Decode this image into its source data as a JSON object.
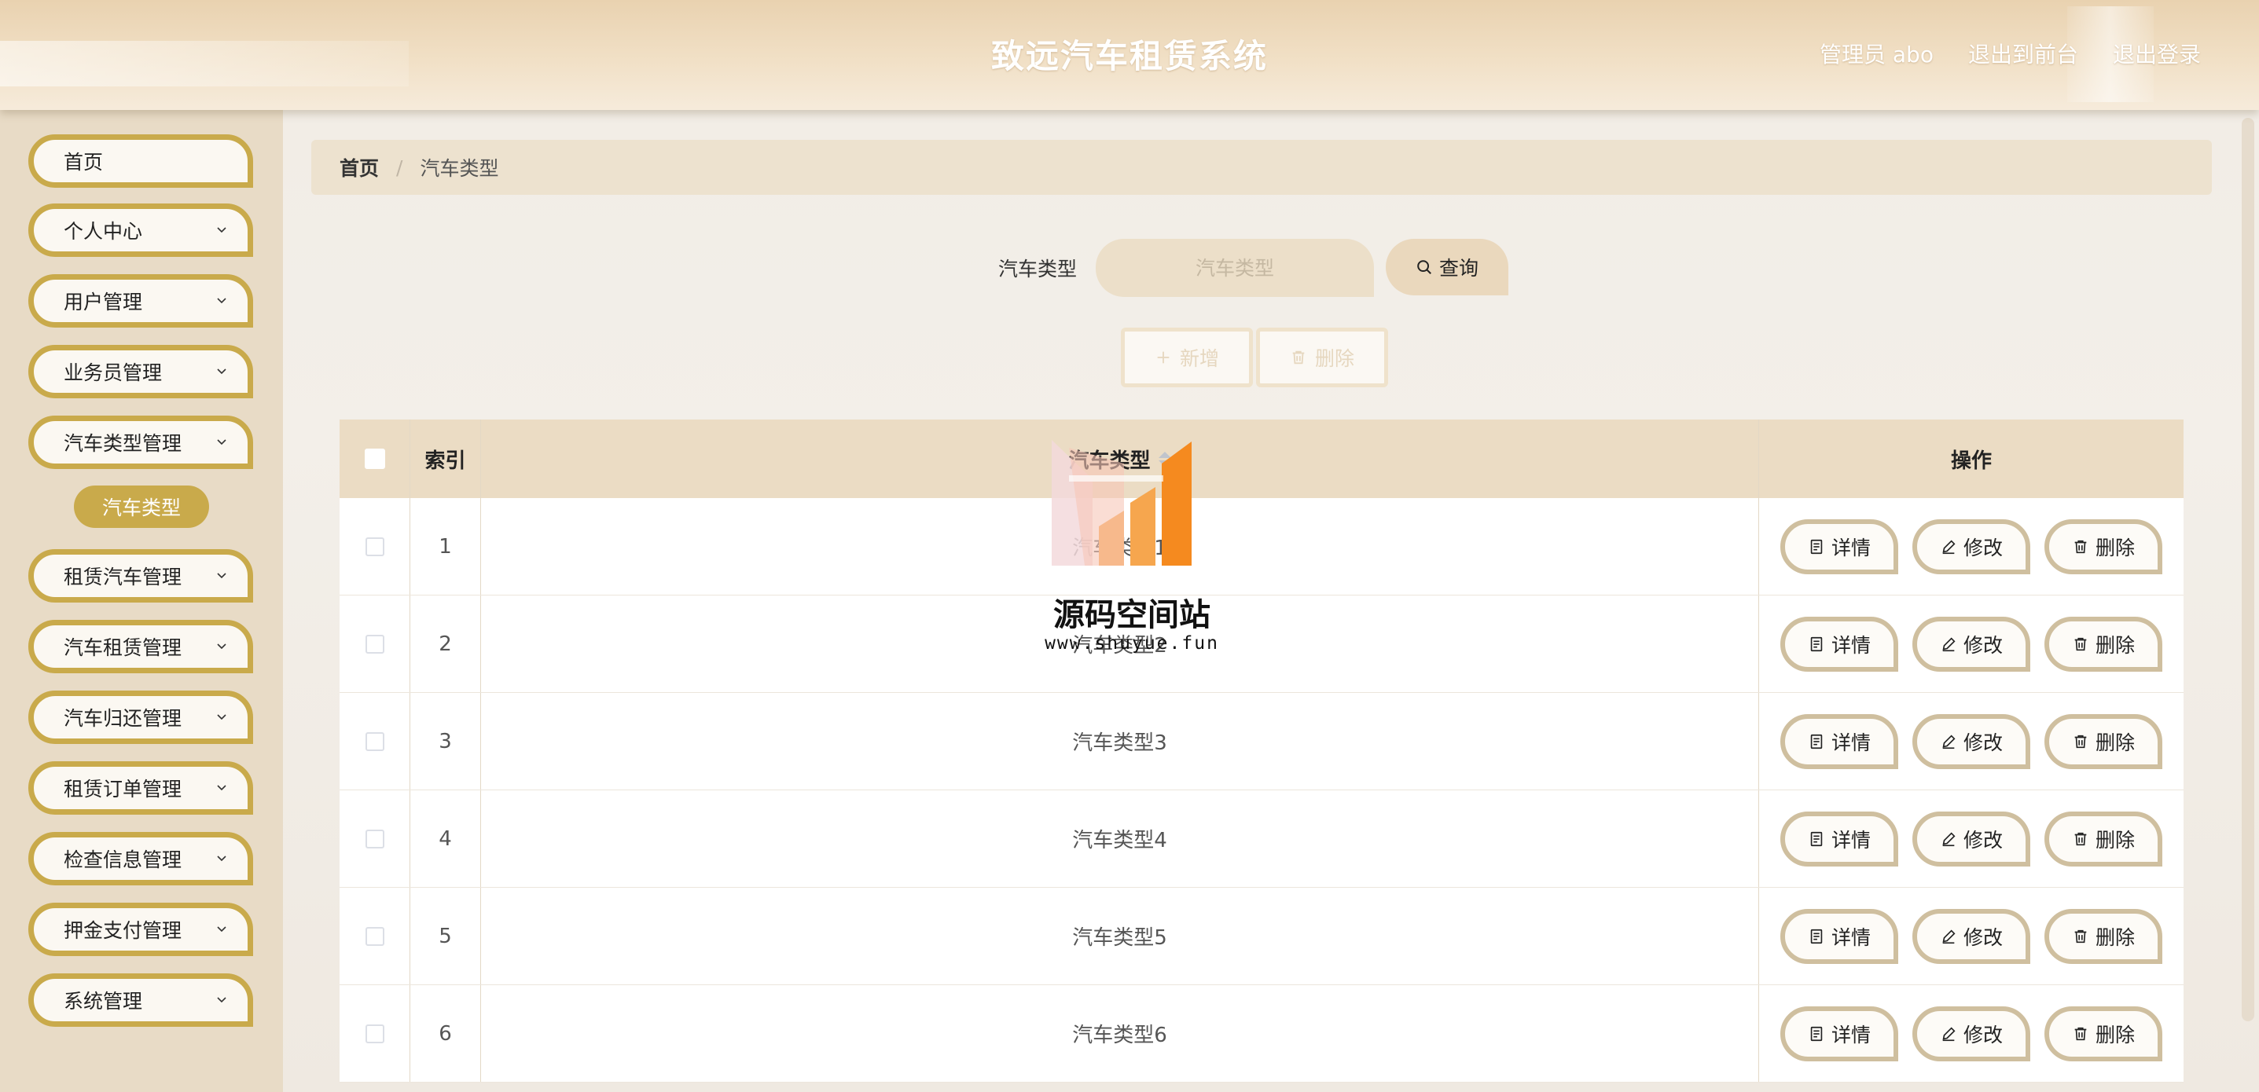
{
  "header": {
    "title": "致远汽车租赁系统",
    "user": "管理员 abo",
    "to_front": "退出到前台",
    "logout": "退出登录"
  },
  "sidebar": {
    "items": [
      {
        "label": "首页",
        "has_children": false
      },
      {
        "label": "个人中心",
        "has_children": true
      },
      {
        "label": "用户管理",
        "has_children": true
      },
      {
        "label": "业务员管理",
        "has_children": true
      },
      {
        "label": "汽车类型管理",
        "has_children": true
      },
      {
        "label": "租赁汽车管理",
        "has_children": true
      },
      {
        "label": "汽车租赁管理",
        "has_children": true
      },
      {
        "label": "汽车归还管理",
        "has_children": true
      },
      {
        "label": "租赁订单管理",
        "has_children": true
      },
      {
        "label": "检查信息管理",
        "has_children": true
      },
      {
        "label": "押金支付管理",
        "has_children": true
      },
      {
        "label": "系统管理",
        "has_children": true
      }
    ],
    "active_sub": "汽车类型"
  },
  "breadcrumb": {
    "home": "首页",
    "separator": "/",
    "current": "汽车类型"
  },
  "search": {
    "label": "汽车类型",
    "placeholder": "汽车类型",
    "value": "",
    "query_label": "查询"
  },
  "toolbar": {
    "add_label": "新增",
    "delete_label": "删除"
  },
  "table": {
    "headers": {
      "index": "索引",
      "type": "汽车类型",
      "actions": "操作"
    },
    "rows": [
      {
        "index": "1",
        "type": "汽车类型1"
      },
      {
        "index": "2",
        "type": "汽车类型2"
      },
      {
        "index": "3",
        "type": "汽车类型3"
      },
      {
        "index": "4",
        "type": "汽车类型4"
      },
      {
        "index": "5",
        "type": "汽车类型5"
      },
      {
        "index": "6",
        "type": "汽车类型6"
      }
    ],
    "row_actions": {
      "detail": "详情",
      "edit": "修改",
      "delete": "删除"
    }
  },
  "watermark": {
    "name": "源码空间站",
    "url": "www.shuyue.fun"
  },
  "colors": {
    "accent": "#c9aa4b",
    "header_bg": "#ebd6b5",
    "table_head": "#ebdcc4"
  }
}
